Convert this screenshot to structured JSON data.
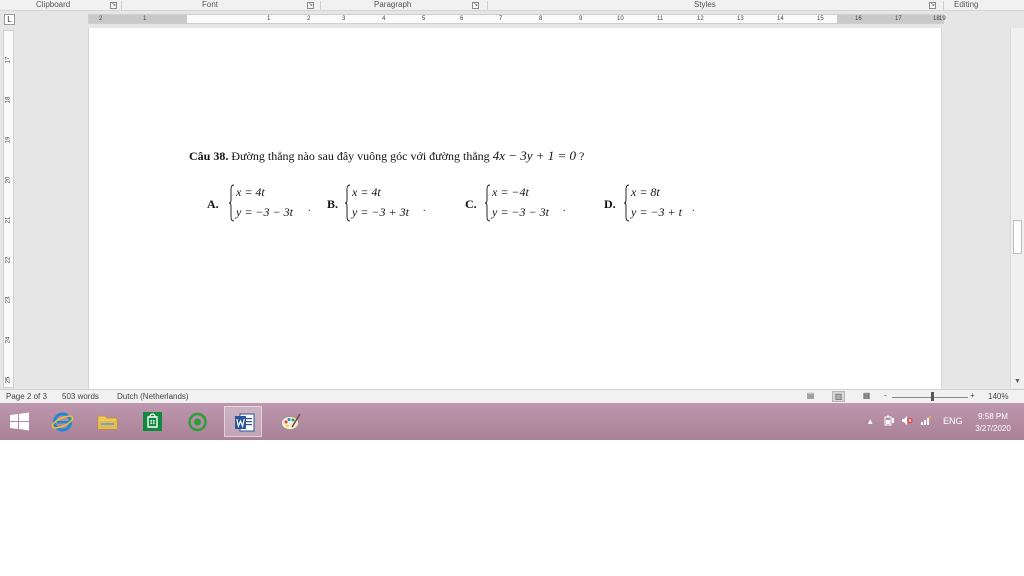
{
  "ribbon": {
    "groups": [
      {
        "label": "Clipboard"
      },
      {
        "label": "Font"
      },
      {
        "label": "Paragraph"
      },
      {
        "label": "Styles"
      },
      {
        "label": "Editing"
      }
    ]
  },
  "ruler": {
    "tab_selector": "L",
    "h_numbers": [
      "2",
      "1",
      "1",
      "2",
      "3",
      "4",
      "5",
      "6",
      "7",
      "8",
      "9",
      "10",
      "11",
      "12",
      "13",
      "14",
      "15",
      "16",
      "17",
      "18",
      "19"
    ],
    "v_numbers": [
      "17",
      "18",
      "19",
      "20",
      "21",
      "22",
      "23",
      "24",
      "25"
    ]
  },
  "document": {
    "question": {
      "number": "Câu 38.",
      "text": " Đường thẳng nào sau đây vuông góc với đường thẳng ",
      "equation": "4x − 3y + 1 = 0",
      "end": " ?"
    },
    "options": [
      {
        "letter": "A.",
        "line1": "x = 4t",
        "line2": "y = −3 − 3t",
        "dot": "."
      },
      {
        "letter": "B.",
        "line1": "x = 4t",
        "line2": "y = −3 + 3t",
        "dot": "."
      },
      {
        "letter": "C.",
        "line1": "x = −4t",
        "line2": "y = −3 − 3t",
        "dot": "."
      },
      {
        "letter": "D.",
        "line1": "x = 8t",
        "line2": "y = −3 + t",
        "dot": "."
      }
    ]
  },
  "status_bar": {
    "page": "Page 2 of 3",
    "words": "503 words",
    "language": "Dutch (Netherlands)",
    "zoom_minus": "-",
    "zoom_plus": "+",
    "zoom": "140%"
  },
  "taskbar": {
    "apps": [
      {
        "name": "start",
        "icon": "windows-logo-icon"
      },
      {
        "name": "internet-explorer",
        "icon": "internet-explorer-icon"
      },
      {
        "name": "file-explorer",
        "icon": "folder-icon"
      },
      {
        "name": "store",
        "icon": "store-icon"
      },
      {
        "name": "app-green",
        "icon": "app-icon"
      },
      {
        "name": "word",
        "icon": "word-icon",
        "active": true
      },
      {
        "name": "paint",
        "icon": "paint-icon"
      }
    ],
    "tray": {
      "chevron": "▴",
      "language": "ENG",
      "time": "9:58 PM",
      "date": "3/27/2020"
    }
  },
  "colors": {
    "taskbar": "#b48ea5",
    "word_blue": "#2b579a",
    "ie_blue": "#1e88d8",
    "store_green": "#10893e"
  }
}
